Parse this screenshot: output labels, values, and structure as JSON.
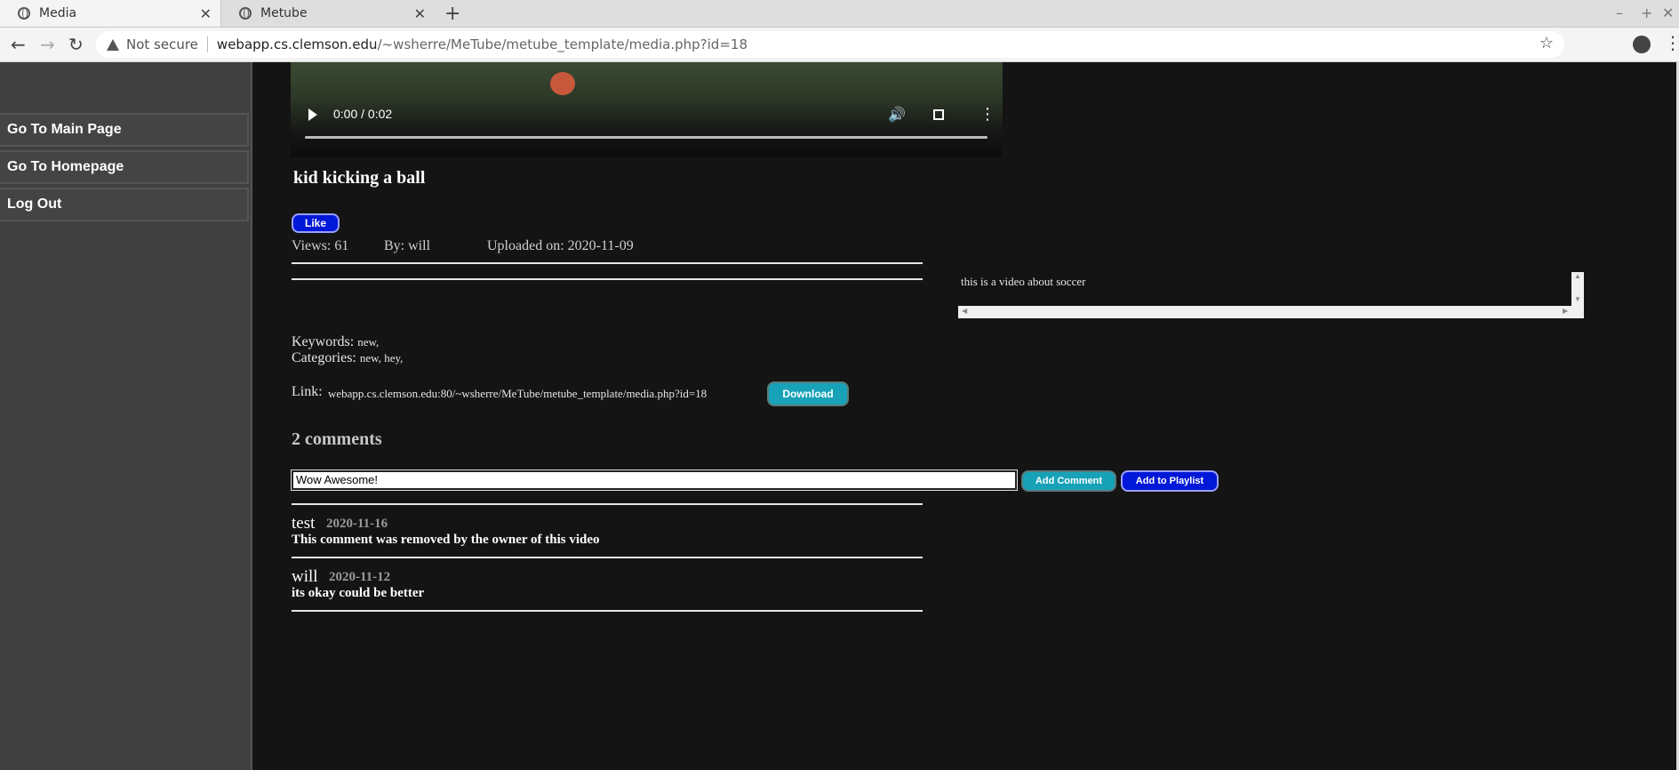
{
  "browser": {
    "tabs": [
      {
        "title": "Media",
        "active": true
      },
      {
        "title": "Metube",
        "active": false
      }
    ],
    "security_label": "Not secure",
    "url_host": "webapp.cs.clemson.edu",
    "url_path": "/~wsherre/MeTube/metube_template/media.php?id=18"
  },
  "sidebar": {
    "items": [
      {
        "label": "Go To Main Page"
      },
      {
        "label": "Go To Homepage"
      },
      {
        "label": "Log Out"
      }
    ]
  },
  "video": {
    "time": "0:00 / 0:02",
    "progress": 0
  },
  "media": {
    "title": "kid kicking a ball",
    "like_label": "Like",
    "views": "Views: 61",
    "author": "By: will",
    "uploaded": "Uploaded on: 2020-11-09",
    "description": "this is a video about soccer",
    "keywords_label": "Keywords:",
    "keywords": "new,",
    "categories_label": "Categories:",
    "categories": "new, hey,",
    "link_label": "Link:",
    "link_url": "webapp.cs.clemson.edu:80/~wsherre/MeTube/metube_template/media.php?id=18",
    "download_label": "Download"
  },
  "comments": {
    "count_label": "2 comments",
    "input_value": "Wow Awesome!",
    "add_comment_label": "Add Comment",
    "add_playlist_label": "Add to Playlist",
    "items": [
      {
        "author": "test",
        "date": "2020-11-16",
        "text": "This comment was removed by the owner of this video"
      },
      {
        "author": "will",
        "date": "2020-11-12",
        "text": "its okay could be better"
      }
    ]
  },
  "colors": {
    "page_bg": "#141414",
    "sidebar_bg": "#404040",
    "like_button": "#0018d8",
    "download_button": "#17a2b8"
  }
}
